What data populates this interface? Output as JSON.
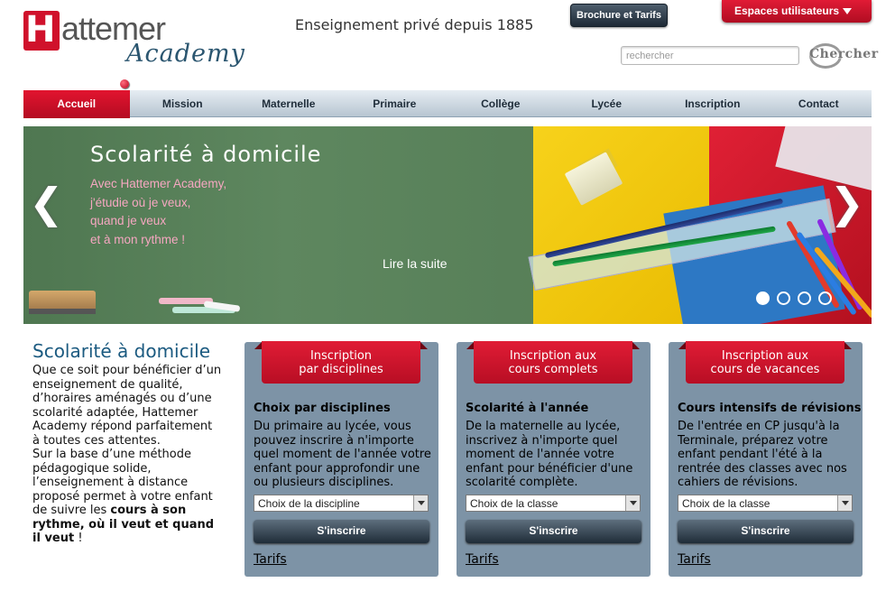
{
  "header": {
    "logo_h": "H",
    "logo_hat": "attemer",
    "logo_academy": "Academy",
    "tagline": "Enseignement privé depuis 1885",
    "brochure_label": "Brochure et Tarifs",
    "espaces_label": "Espaces utilisateurs",
    "search_placeholder": "rechercher",
    "search_button": "Chercher"
  },
  "nav": {
    "items": [
      "Accueil",
      "Mission",
      "Maternelle",
      "Primaire",
      "Collège",
      "Lycée",
      "Inscription",
      "Contact"
    ],
    "active": "Accueil"
  },
  "banner": {
    "title": "Scolarité à domicile",
    "text": "Avec Hattemer Academy,\nj'étudie où je veux,\nquand je veux\net à mon rythme !",
    "link": "Lire la suite",
    "prev": "❮",
    "next": "❯",
    "slides": 4,
    "active_slide": 1
  },
  "intro": {
    "title": "Scolarité à domicile",
    "body_1": "Que ce soit pour bénéficier d’un enseignement de qualité, d’horaires aménagés ou d’une scolarité adaptée, Hattemer Academy répond parfaitement à toutes ces attentes.",
    "body_2": "Sur la base d’une méthode pédagogique solide, l’enseignement à distance proposé permet à votre enfant de suivre les ",
    "body_bold": "cours à son rythme, où il veut et quand il veut",
    "body_end": " !"
  },
  "cards": [
    {
      "tab": "Inscription\npar disciplines",
      "heading": "Choix par disciplines",
      "body": "Du primaire au lycée, vous pouvez inscrire à n'importe quel moment de l'année votre enfant pour approfondir une ou plusieurs disciplines.",
      "select": "Choix de la discipline",
      "button": "S'inscrire",
      "link": "Tarifs"
    },
    {
      "tab": "Inscription aux\ncours complets",
      "heading": "Scolarité à l'année",
      "body": "De la maternelle au lycée, inscrivez à n'importe quel moment de l'année votre enfant pour bénéficier d'une scolarité complète.",
      "select": "Choix de la classe",
      "button": "S'inscrire",
      "link": "Tarifs"
    },
    {
      "tab": "Inscription aux\ncours de vacances",
      "heading": "Cours intensifs de révisions",
      "body": "De l'entrée en CP jusqu'à la Terminale, préparez votre enfant pendant l'été à la rentrée des classes avec nos cahiers de révisions.",
      "select": "Choix de la classe",
      "button": "S'inscrire",
      "link": "Tarifs"
    }
  ],
  "colors": {
    "brand_red": "#d0112b",
    "nav_dark": "#1f2d3a",
    "card_bg": "#7d93a6",
    "title_blue": "#1b5a80"
  }
}
